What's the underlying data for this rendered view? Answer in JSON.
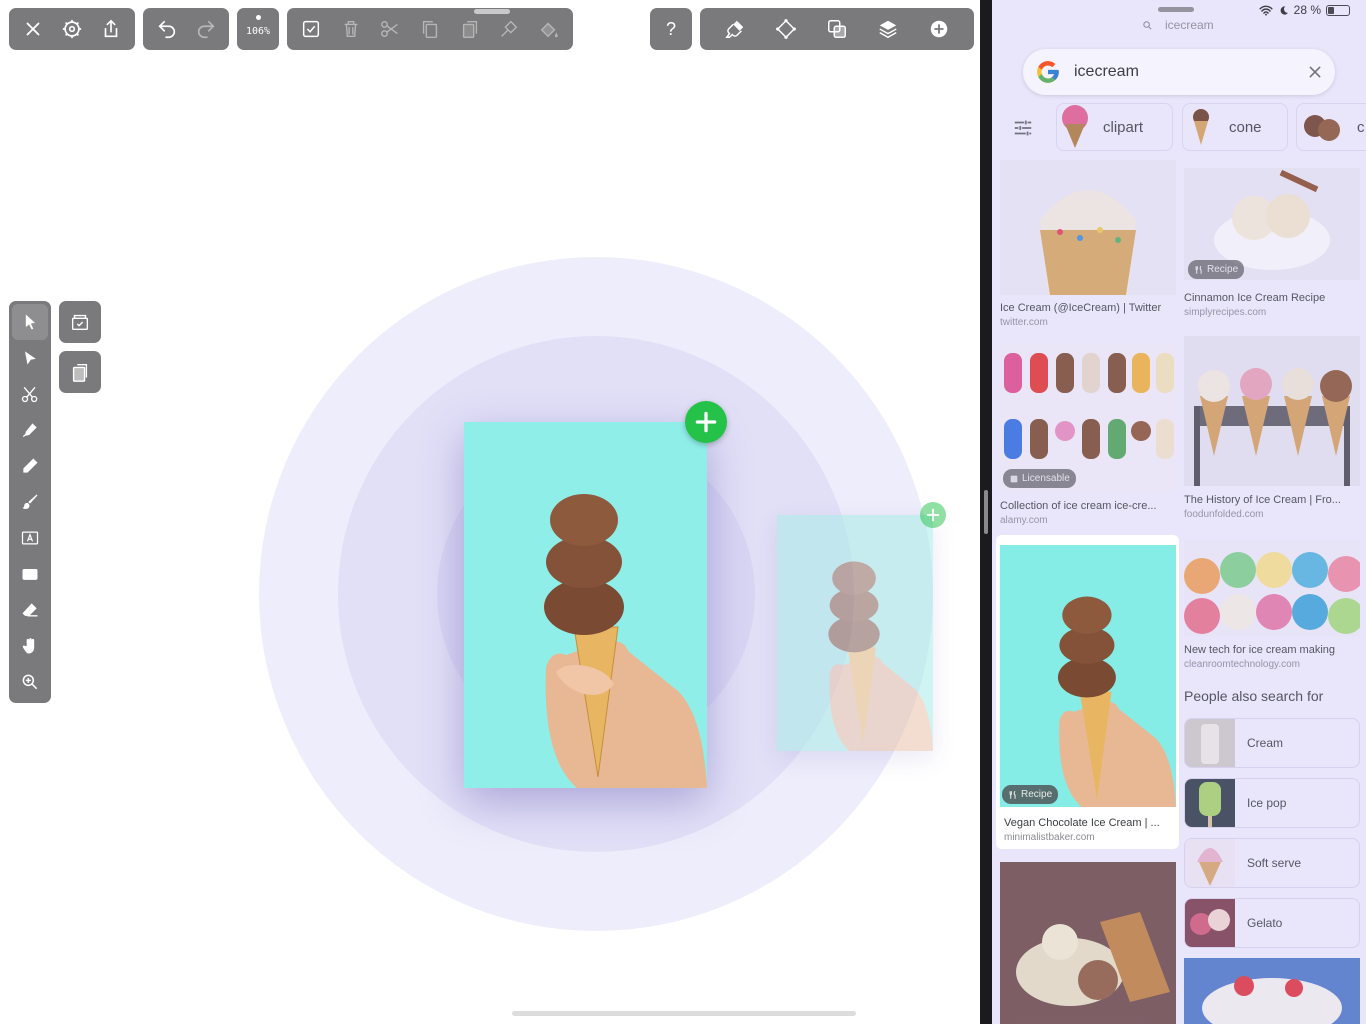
{
  "editor": {
    "toolbar_left": {
      "close": "close-icon",
      "settings": "gear-icon",
      "share": "share-icon"
    },
    "history": {
      "undo": "undo-icon",
      "redo": "redo-icon"
    },
    "zoom_level": "106%",
    "edit_tools": [
      "select-all-icon",
      "trash-icon",
      "scissors-icon",
      "copy-icon",
      "paste-icon",
      "adjust-icon",
      "fill-icon"
    ],
    "help_label": "?",
    "right_tools": [
      "brush-settings-icon",
      "transform-icon",
      "arrange-icon",
      "layers-icon",
      "add-icon"
    ],
    "side_tools": [
      "selection-icon",
      "direct-select-icon",
      "scissors-tool-icon",
      "pen-icon",
      "pencil-icon",
      "brush-icon",
      "text-tool-icon",
      "shape-icon",
      "eraser-icon",
      "hand-icon",
      "zoom-icon"
    ],
    "side_actions": [
      "archive-icon",
      "paste-doc-icon"
    ]
  },
  "browser": {
    "status": {
      "battery": "28 %"
    },
    "url": "icecream",
    "search_query": "icecream",
    "chips": [
      {
        "label": "clipart"
      },
      {
        "label": "cone"
      },
      {
        "label": "c"
      }
    ],
    "results": [
      {
        "title": "Ice Cream (@IceCream) | Twitter",
        "source": "twitter.com"
      },
      {
        "title": "Cinnamon Ice Cream Recipe",
        "source": "simplyrecipes.com",
        "badge": "Recipe"
      },
      {
        "title": "Collection of ice cream ice-cre...",
        "source": "alamy.com",
        "badge": "Licensable"
      },
      {
        "title": "The History of Ice Cream | Fro...",
        "source": "foodunfolded.com"
      },
      {
        "title": "Vegan Chocolate Ice Cream | ...",
        "source": "minimalistbaker.com",
        "badge": "Recipe"
      },
      {
        "title": "New tech for ice cream making",
        "source": "cleanroomtechnology.com"
      }
    ],
    "people_also_search": {
      "heading": "People also search for",
      "items": [
        "Cream",
        "Ice pop",
        "Soft serve",
        "Gelato"
      ]
    }
  }
}
